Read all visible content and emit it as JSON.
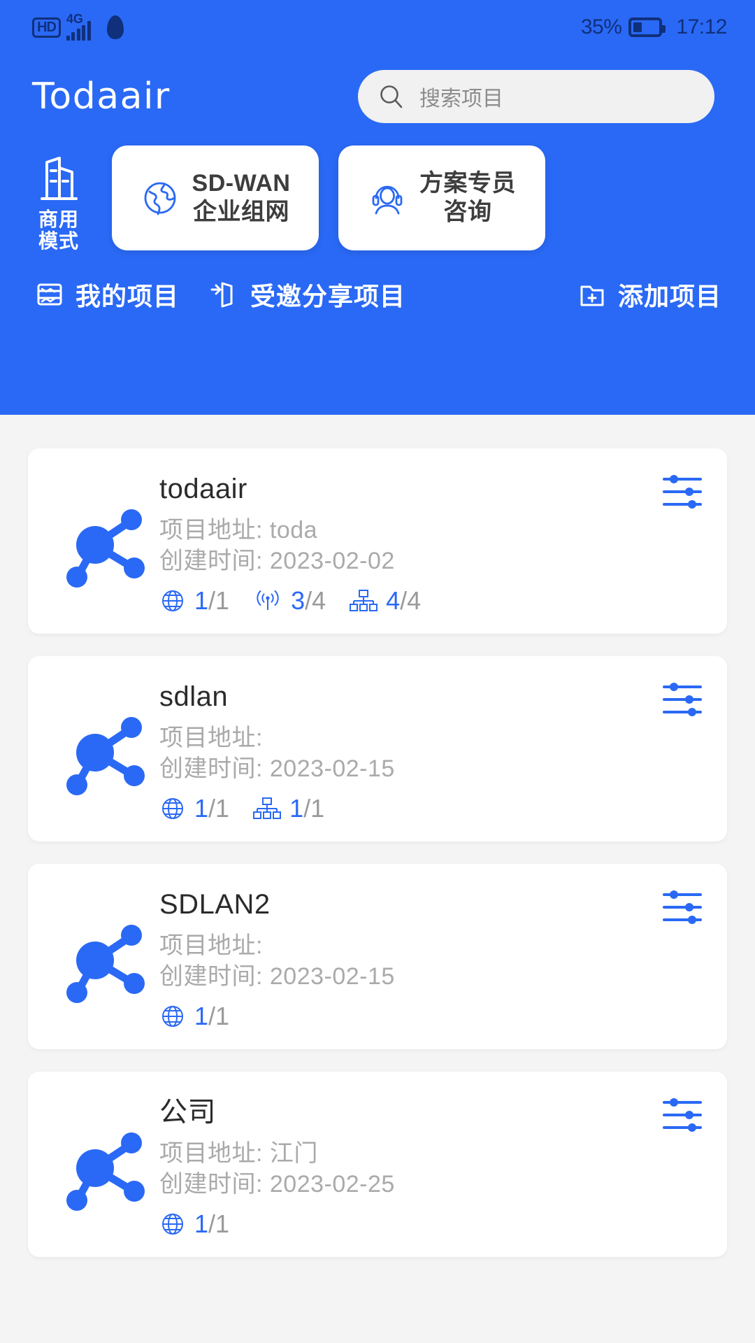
{
  "statusbar": {
    "hd_badge": "HD",
    "network_label": "4G",
    "battery_percent": "35%",
    "battery_level": 35,
    "time": "17:12",
    "icons": [
      "hd-icon",
      "signal-bars-icon",
      "qq-penguin-icon",
      "battery-icon"
    ]
  },
  "header": {
    "brand": "Todaair",
    "search": {
      "placeholder": "搜索项目",
      "value": "",
      "icon": "search-icon"
    },
    "mode": {
      "label_line1": "商用",
      "label_line2": "模式",
      "icon": "building-icon"
    },
    "quick_actions": [
      {
        "line1": "SD-WAN",
        "line2": "企业组网",
        "icon": "globe-icon"
      },
      {
        "line1": "方案专员",
        "line2": "咨询",
        "icon": "headset-support-icon"
      }
    ],
    "nav": [
      {
        "label": "我的项目",
        "icon": "my-projects-icon",
        "active": true
      },
      {
        "label": "受邀分享项目",
        "icon": "shared-projects-icon",
        "active": false
      },
      {
        "label": "添加项目",
        "icon": "add-project-icon",
        "active": false
      }
    ]
  },
  "labels": {
    "address_prefix": "项目地址:",
    "created_prefix": "创建时间:"
  },
  "colors": {
    "brand_blue": "#2a69f5",
    "page_bg": "#f4f4f4",
    "card_bg": "#ffffff",
    "muted_text": "#aaaaaa",
    "title_text": "#2b2b2b",
    "status_dark": "#10307c"
  },
  "projects": [
    {
      "name": "todaair",
      "address_label": "项目地址: toda",
      "created_label": "创建时间: 2023-02-02",
      "stats": [
        {
          "icon": "globe-icon",
          "current": "1",
          "total": "1"
        },
        {
          "icon": "wireless-signal-icon",
          "current": "3",
          "total": "4"
        },
        {
          "icon": "network-topology-icon",
          "current": "4",
          "total": "4"
        }
      ]
    },
    {
      "name": "sdlan",
      "address_label": "项目地址:",
      "created_label": "创建时间: 2023-02-15",
      "stats": [
        {
          "icon": "globe-icon",
          "current": "1",
          "total": "1"
        },
        {
          "icon": "network-topology-icon",
          "current": "1",
          "total": "1"
        }
      ]
    },
    {
      "name": "SDLAN2",
      "address_label": "项目地址:",
      "created_label": "创建时间: 2023-02-15",
      "stats": [
        {
          "icon": "globe-icon",
          "current": "1",
          "total": "1"
        }
      ]
    },
    {
      "name": "公司",
      "address_label": "项目地址: 江门",
      "created_label": "创建时间: 2023-02-25",
      "stats": [
        {
          "icon": "globe-icon",
          "current": "1",
          "total": "1"
        }
      ]
    }
  ]
}
